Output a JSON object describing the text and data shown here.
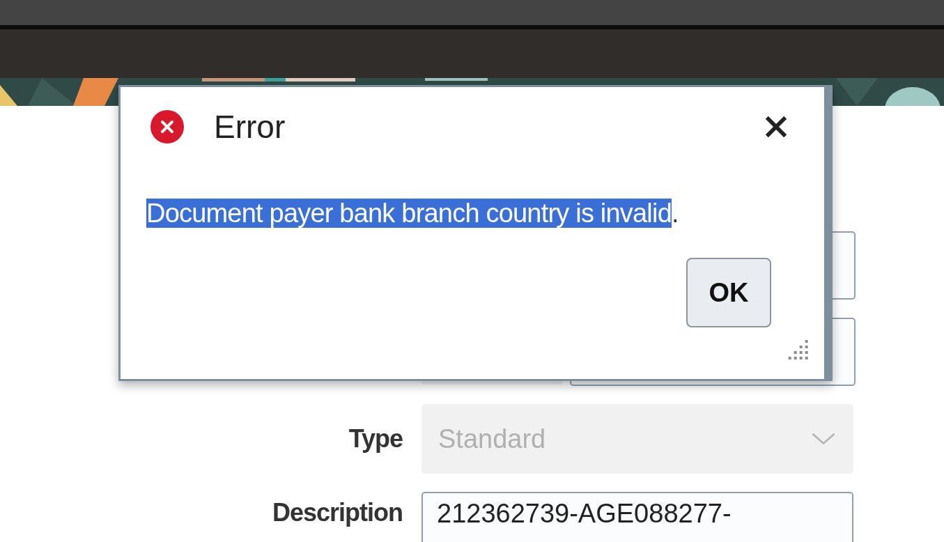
{
  "dialog": {
    "title": "Error",
    "message_parts": [
      {
        "text": "Document payer bank branch country is invalid",
        "selected": true
      },
      {
        "text": ".",
        "selected": false
      }
    ],
    "buttons": [
      "OK"
    ]
  },
  "form": {
    "rows": [
      {
        "kind": "field"
      },
      {
        "kind": "split"
      },
      {
        "kind": "select",
        "label": "Type",
        "value": "Standard",
        "disabled": true
      },
      {
        "kind": "text",
        "label": "Description",
        "value": "212362739-AGE088277-",
        "disabled": false
      }
    ]
  }
}
